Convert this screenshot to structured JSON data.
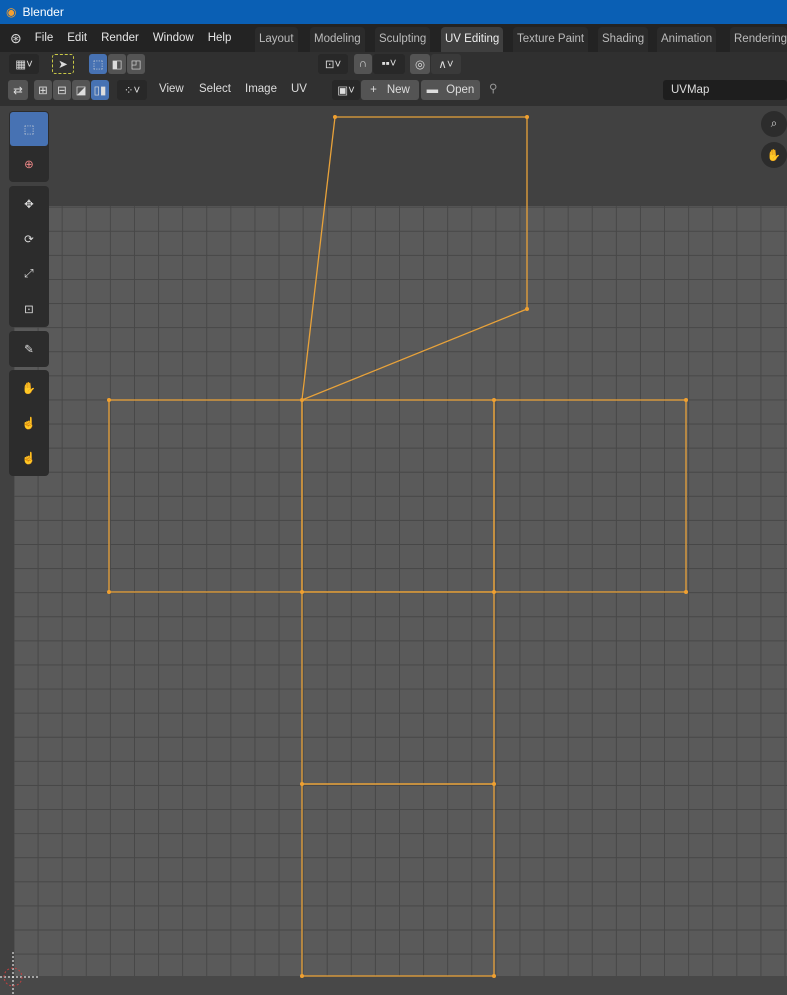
{
  "window": {
    "title": "Blender"
  },
  "menu": [
    "File",
    "Edit",
    "Render",
    "Window",
    "Help"
  ],
  "workspaces": [
    {
      "label": "Layout"
    },
    {
      "label": "Modeling"
    },
    {
      "label": "Sculpting"
    },
    {
      "label": "UV Editing",
      "active": true
    },
    {
      "label": "Texture Paint"
    },
    {
      "label": "Shading"
    },
    {
      "label": "Animation"
    },
    {
      "label": "Rendering"
    }
  ],
  "header": {
    "view": "View",
    "select": "Select",
    "image": "Image",
    "uv": "UV",
    "new": "New",
    "open": "Open",
    "uvmap": "UVMap"
  },
  "colors": {
    "accent": "#4772b3",
    "uv_edge": "#e8a23a",
    "titlebar": "#0a5fb4"
  }
}
